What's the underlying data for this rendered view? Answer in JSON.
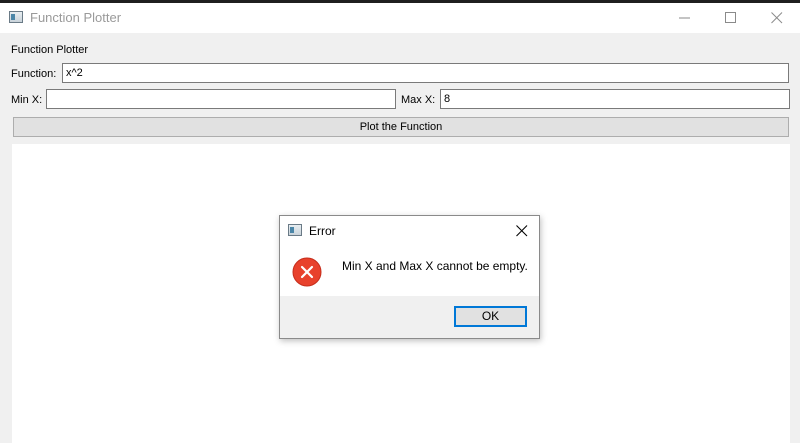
{
  "window": {
    "title": "Function Plotter"
  },
  "app": {
    "heading": "Function Plotter",
    "function_label": "Function:",
    "function_value": "x^2",
    "min_x_label": "Min X:",
    "min_x_value": "",
    "max_x_label": "Max X:",
    "max_x_value": "8",
    "plot_button_label": "Plot the Function"
  },
  "dialog": {
    "title": "Error",
    "message": "Min X and Max X cannot be empty.",
    "ok_label": "OK",
    "icon": "error-icon"
  },
  "colors": {
    "error_red": "#e8412c",
    "focus_blue": "#0078d7"
  }
}
